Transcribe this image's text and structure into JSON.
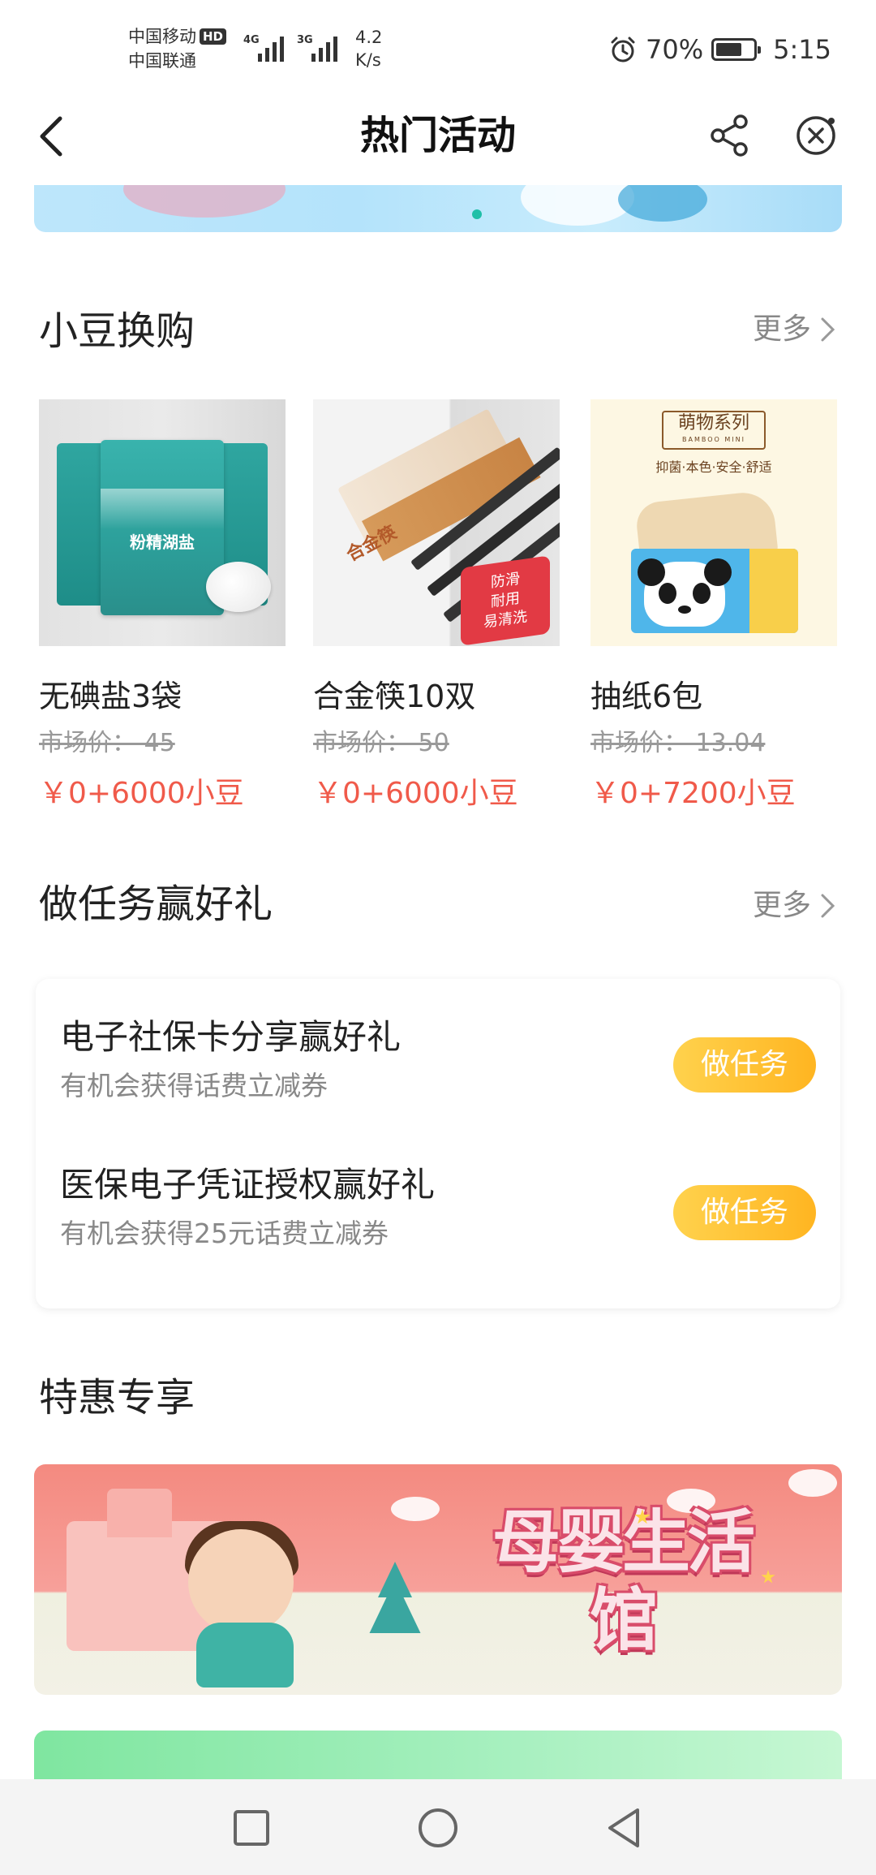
{
  "status_bar": {
    "carrier_1": "中国移动",
    "carrier_1_badge": "HD",
    "carrier_2": "中国联通",
    "signal_1_type": "4G",
    "signal_2_type": "3G",
    "net_speed_value": "4.2",
    "net_speed_unit": "K/s",
    "battery_percent": "70%",
    "battery_level": 0.7,
    "time": "5:15"
  },
  "header": {
    "title": "热门活动",
    "icons": [
      "back-arrow-icon",
      "share-icon",
      "close-miniapp-icon"
    ]
  },
  "banner_top": {
    "indicator_color": "#1fbfa8"
  },
  "points_exchange": {
    "title": "小豆换购",
    "more_label": "更多",
    "products": [
      {
        "name": "无碘盐3袋",
        "market_price": "市场价： 45",
        "price": "￥0+6000小豆"
      },
      {
        "name": "合金筷10双",
        "market_price": "市场价： 50",
        "price": "￥0+6000小豆"
      },
      {
        "name": "抽纸6包",
        "market_price": "市场价： 13.04",
        "price": "￥0+7200小豆"
      }
    ],
    "product_images": {
      "salt_label": "粉精湖盐",
      "chopsticks_label": "合金筷",
      "chopsticks_badge": [
        "防滑",
        "耐用",
        "易清洗"
      ],
      "tissue_series": "萌物系列",
      "tissue_series_en": "BAMBOO MINI",
      "tissue_tagline": "抑菌·本色·安全·舒适"
    }
  },
  "tasks": {
    "title": "做任务赢好礼",
    "more_label": "更多",
    "items": [
      {
        "name": "电子社保卡分享赢好礼",
        "desc": "有机会获得话费立减券",
        "button": "做任务"
      },
      {
        "name": "医保电子凭证授权赢好礼",
        "desc": "有机会获得25元话费立减券",
        "button": "做任务"
      }
    ]
  },
  "specials": {
    "title": "特惠专享",
    "banner_text": "母婴生活馆"
  },
  "colors": {
    "price_red": "#f05a4a",
    "task_button": "#ffb521",
    "accent_teal": "#1fbfa8"
  },
  "nav_bar": {
    "icons": [
      "recent-apps-icon",
      "home-icon",
      "back-icon"
    ]
  }
}
